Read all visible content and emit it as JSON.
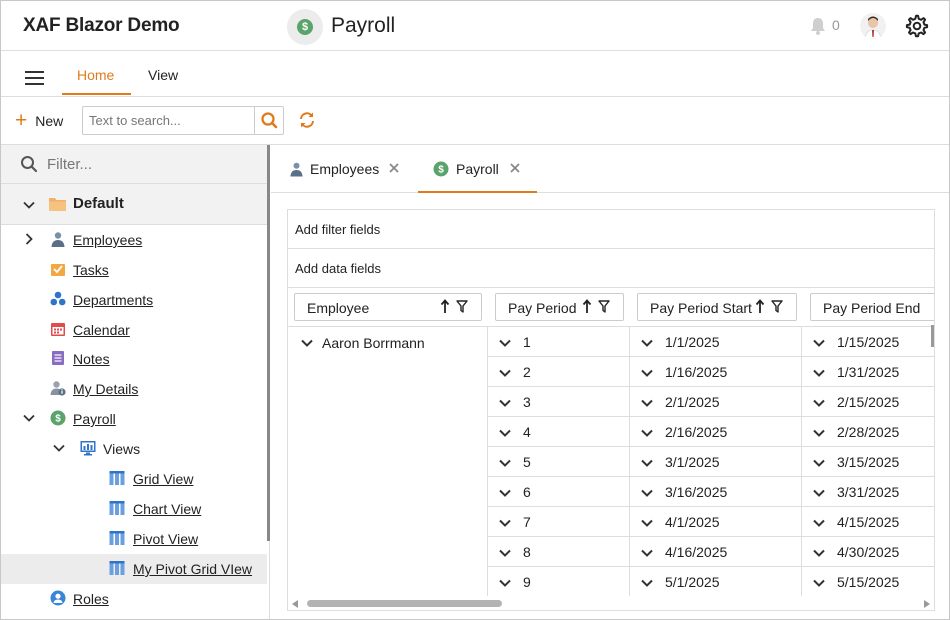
{
  "header": {
    "app_title": "XAF Blazor Demo",
    "view_title": "Payroll",
    "notification_count": "0",
    "icons": {
      "view": "payroll-coin-icon",
      "bell": "bell-icon",
      "avatar": "user-avatar",
      "settings": "gear-icon"
    }
  },
  "ribbon": {
    "tabs": [
      {
        "label": "Home",
        "active": true
      },
      {
        "label": "View",
        "active": false
      }
    ]
  },
  "toolbar": {
    "new_label": "New",
    "search_placeholder": "Text to search...",
    "icons": {
      "new": "plus-icon",
      "search": "search-icon",
      "refresh": "refresh-icon"
    }
  },
  "sidebar": {
    "filter_placeholder": "Filter...",
    "group": {
      "label": "Default",
      "expanded": true
    },
    "items": [
      {
        "label": "Employees",
        "icon": "employee-icon",
        "expandable": true,
        "expanded": false
      },
      {
        "label": "Tasks",
        "icon": "tasks-icon"
      },
      {
        "label": "Departments",
        "icon": "departments-icon"
      },
      {
        "label": "Calendar",
        "icon": "calendar-icon"
      },
      {
        "label": "Notes",
        "icon": "notes-icon"
      },
      {
        "label": "My Details",
        "icon": "my-details-icon"
      },
      {
        "label": "Payroll",
        "icon": "payroll-icon",
        "expandable": true,
        "expanded": true
      },
      {
        "label": "Views",
        "icon": "views-icon",
        "expandable": true,
        "expanded": true
      },
      {
        "label": "Grid View",
        "icon": "grid-view-icon"
      },
      {
        "label": "Chart View",
        "icon": "grid-view-icon"
      },
      {
        "label": "Pivot View",
        "icon": "grid-view-icon"
      },
      {
        "label": "My Pivot Grid VIew",
        "icon": "grid-view-icon",
        "selected": true
      },
      {
        "label": "Roles",
        "icon": "roles-icon"
      }
    ]
  },
  "doc_tabs": [
    {
      "label": "Employees",
      "icon": "employee-icon",
      "active": false
    },
    {
      "label": "Payroll",
      "icon": "payroll-icon",
      "active": true
    }
  ],
  "pivot": {
    "filter_area": "Add filter fields",
    "data_area": "Add data fields",
    "fields": [
      {
        "label": "Employee",
        "sorted": "ascending",
        "filter": true
      },
      {
        "label": "Pay Period",
        "sorted": "ascending",
        "filter": true
      },
      {
        "label": "Pay Period Start",
        "sorted": "ascending",
        "filter": true
      },
      {
        "label": "Pay Period End"
      }
    ],
    "row_header": "Aaron Borrmann",
    "rows": [
      {
        "period": "1",
        "start": "1/1/2025",
        "end": "1/15/2025"
      },
      {
        "period": "2",
        "start": "1/16/2025",
        "end": "1/31/2025"
      },
      {
        "period": "3",
        "start": "2/1/2025",
        "end": "2/15/2025"
      },
      {
        "period": "4",
        "start": "2/16/2025",
        "end": "2/28/2025"
      },
      {
        "period": "5",
        "start": "3/1/2025",
        "end": "3/15/2025"
      },
      {
        "period": "6",
        "start": "3/16/2025",
        "end": "3/31/2025"
      },
      {
        "period": "7",
        "start": "4/1/2025",
        "end": "4/15/2025"
      },
      {
        "period": "8",
        "start": "4/16/2025",
        "end": "4/30/2025"
      },
      {
        "period": "9",
        "start": "5/1/2025",
        "end": "5/15/2025"
      }
    ]
  },
  "colors": {
    "accent": "#e07b1c",
    "payroll_green": "#5aa36a",
    "grid_blue": "#3a7bd5"
  }
}
